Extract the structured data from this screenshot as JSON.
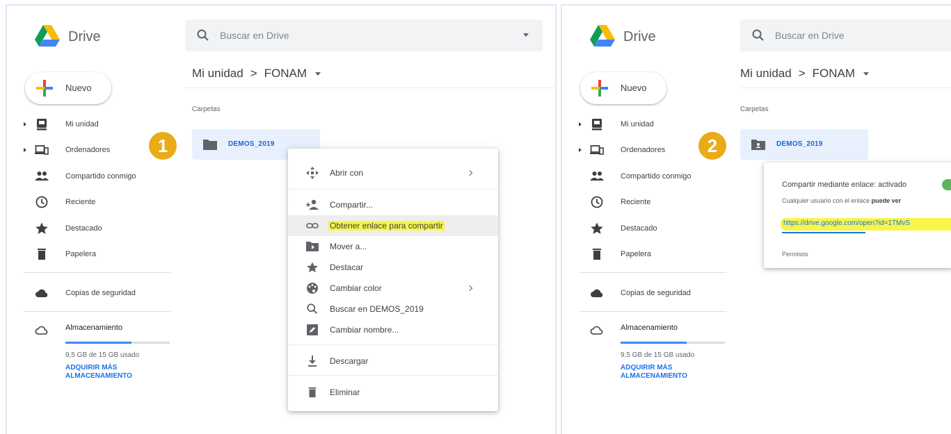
{
  "colors": {
    "accent": "#1a73e8",
    "badge": "#e9ab16",
    "highlight": "#f7f54c",
    "folder_bg": "#e8f0fe"
  },
  "app": {
    "name": "Drive"
  },
  "search": {
    "placeholder": "Buscar en Drive"
  },
  "breadcrumb": {
    "root": "Mi unidad",
    "separator": ">",
    "current": "FONAM"
  },
  "new_button": {
    "label": "Nuevo"
  },
  "sidebar": {
    "items": [
      {
        "label": "Mi unidad",
        "icon": "drive-icon"
      },
      {
        "label": "Ordenadores",
        "icon": "computers-icon"
      },
      {
        "label": "Compartido conmigo",
        "icon": "people-icon"
      },
      {
        "label": "Reciente",
        "icon": "clock-icon"
      },
      {
        "label": "Destacado",
        "icon": "star-icon"
      },
      {
        "label": "Papelera",
        "icon": "trash-icon"
      }
    ],
    "backup": {
      "label": "Copias de seguridad",
      "icon": "cloud-icon"
    },
    "storage": {
      "label": "Almacenamiento",
      "used": "9,5 GB de 15 GB usado",
      "used_fraction": 0.63,
      "link": "ADQUIRIR MÁS ALMACENAMIENTO"
    }
  },
  "content": {
    "section_title": "Carpetas",
    "folder_name": "DEMOS_2019"
  },
  "steps": {
    "one": "1",
    "two": "2"
  },
  "context_menu": {
    "items": [
      {
        "label": "Abrir con",
        "icon": "open-with-icon",
        "submenu": true
      },
      {
        "label": "Compartir...",
        "icon": "share-person-icon",
        "submenu": false
      },
      {
        "label": "Obtener enlace para compartir",
        "icon": "link-icon",
        "submenu": false,
        "highlighted": true
      },
      {
        "label": "Mover a...",
        "icon": "move-folder-icon",
        "submenu": false
      },
      {
        "label": "Destacar",
        "icon": "star-icon",
        "submenu": false
      },
      {
        "label": "Cambiar color",
        "icon": "palette-icon",
        "submenu": true
      },
      {
        "label": "Buscar en DEMOS_2019",
        "icon": "search-icon",
        "submenu": false
      },
      {
        "label": "Cambiar nombre...",
        "icon": "rename-icon",
        "submenu": false
      },
      {
        "label": "Descargar",
        "icon": "download-icon",
        "submenu": false
      },
      {
        "label": "Eliminar",
        "icon": "trash-icon",
        "submenu": false
      }
    ]
  },
  "share_popup": {
    "title": "Compartir mediante enlace: activado",
    "subtitle_prefix": "Cualquier usuario con el enlace",
    "subtitle_permission": "puede ver",
    "link": "https://drive.google.com/open?id=1TMvS",
    "permissions_label": "Permisos"
  }
}
